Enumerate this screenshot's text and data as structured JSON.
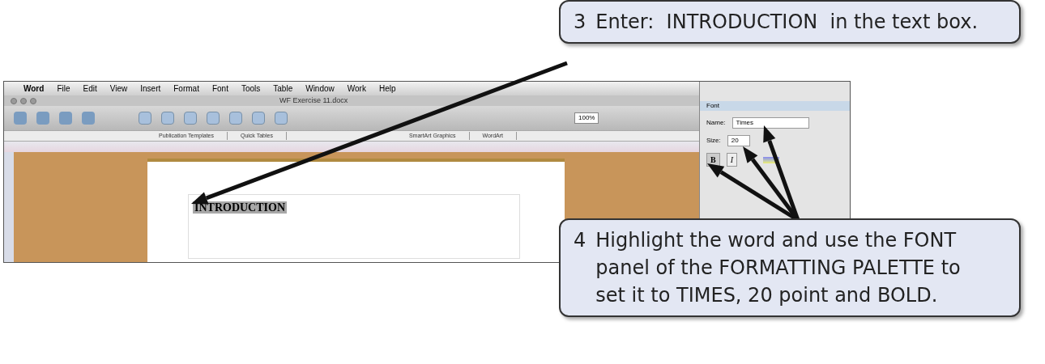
{
  "app": {
    "menu": [
      "Word",
      "File",
      "Edit",
      "View",
      "Insert",
      "Format",
      "Font",
      "Tools",
      "Table",
      "Window",
      "Work",
      "Help"
    ],
    "title": "WF Exercise 11.docx",
    "zoom": "100%",
    "ribbon_tabs": [
      "Publication Templates",
      "Quick Tables",
      "SmartArt Graphics",
      "WordArt"
    ],
    "document_text": "INTRODUCTION",
    "palette": {
      "section": "Font",
      "name_label": "Name:",
      "name_value": "Times",
      "size_label": "Size:",
      "size_value": "20",
      "bold_button": "B",
      "italic_button": "I"
    }
  },
  "callouts": [
    {
      "number": "3",
      "text": "Enter:  INTRODUCTION  in the text box."
    },
    {
      "number": "4",
      "text": "Highlight the word and use the FONT panel of the FORMATTING PALETTE to set it to TIMES, 20 point and BOLD."
    }
  ]
}
